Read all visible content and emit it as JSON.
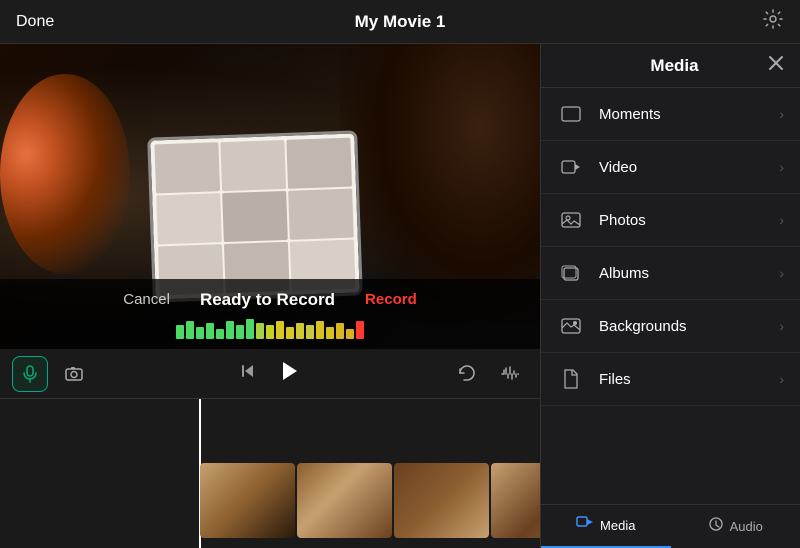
{
  "topBar": {
    "done": "Done",
    "title": "My Movie 1",
    "gearIcon": "⚙"
  },
  "videoPreview": {
    "cancelLabel": "Cancel",
    "readyToRecord": "Ready to Record",
    "recordLabel": "Record"
  },
  "rightPanel": {
    "title": "Media",
    "closeIcon": "✕",
    "mediaItems": [
      {
        "id": "moments",
        "label": "Moments",
        "icon": "▭"
      },
      {
        "id": "video",
        "label": "Video",
        "icon": "▬"
      },
      {
        "id": "photos",
        "label": "Photos",
        "icon": "▭"
      },
      {
        "id": "albums",
        "label": "Albums",
        "icon": "▭"
      },
      {
        "id": "backgrounds",
        "label": "Backgrounds",
        "icon": "🖼"
      },
      {
        "id": "files",
        "label": "Files",
        "icon": "📁"
      }
    ],
    "tabs": [
      {
        "id": "media",
        "label": "Media",
        "icon": "▬",
        "active": true
      },
      {
        "id": "audio",
        "label": "Audio",
        "icon": "♪",
        "active": false
      }
    ]
  },
  "timeline": {
    "micIcon": "🎙",
    "cameraIcon": "📷",
    "skipIcon": "⏮",
    "playIcon": "▶",
    "undoIcon": "↩",
    "waveIcon": "〰"
  }
}
